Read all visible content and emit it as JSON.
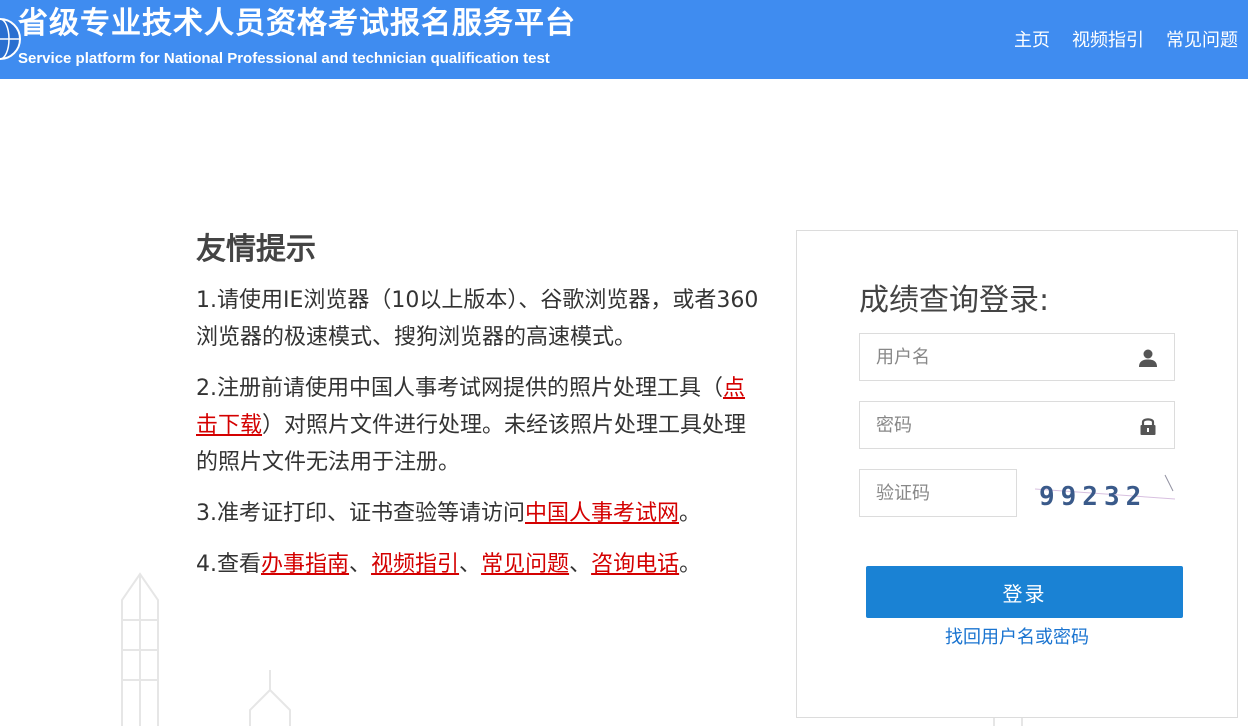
{
  "header": {
    "title_cn": "省级专业技术人员资格考试报名服务平台",
    "title_en": "Service platform for National Professional and technician qualification test",
    "nav": [
      {
        "label": "主页"
      },
      {
        "label": "视频指引"
      },
      {
        "label": "常见问题"
      }
    ]
  },
  "tips": {
    "title": "友情提示",
    "tip1": "1.请使用IE浏览器（10以上版本）、谷歌浏览器，或者360浏览器的极速模式、搜狗浏览器的高速模式。",
    "tip2": {
      "pre": "2.注册前请使用中国人事考试网提供的照片处理工具（",
      "link": "点击下载",
      "post": "）对照片文件进行处理。未经该照片处理工具处理的照片文件无法用于注册。"
    },
    "tip3": {
      "pre": "3.准考证打印、证书查验等请访问",
      "link": "中国人事考试网",
      "post": "。"
    },
    "tip4": {
      "pre": "4.查看",
      "link1": "办事指南",
      "sep1": "、",
      "link2": "视频指引",
      "sep2": "、",
      "link3": "常见问题",
      "sep3": "、",
      "link4": "咨询电话",
      "post": "。"
    }
  },
  "login": {
    "title": "成绩查询登录:",
    "username_placeholder": "用户名",
    "password_placeholder": "密码",
    "captcha_placeholder": "验证码",
    "captcha_value": "99232",
    "login_button": "登录",
    "forgot_link": "找回用户名或密码"
  },
  "icons": {
    "username": "user-icon",
    "password": "lock-icon",
    "logo": "globe-logo-icon"
  },
  "colors": {
    "header_bg": "#3f8cf0",
    "link_red": "#d40000",
    "button_blue": "#1a82d4",
    "link_blue": "#1a74d0"
  }
}
